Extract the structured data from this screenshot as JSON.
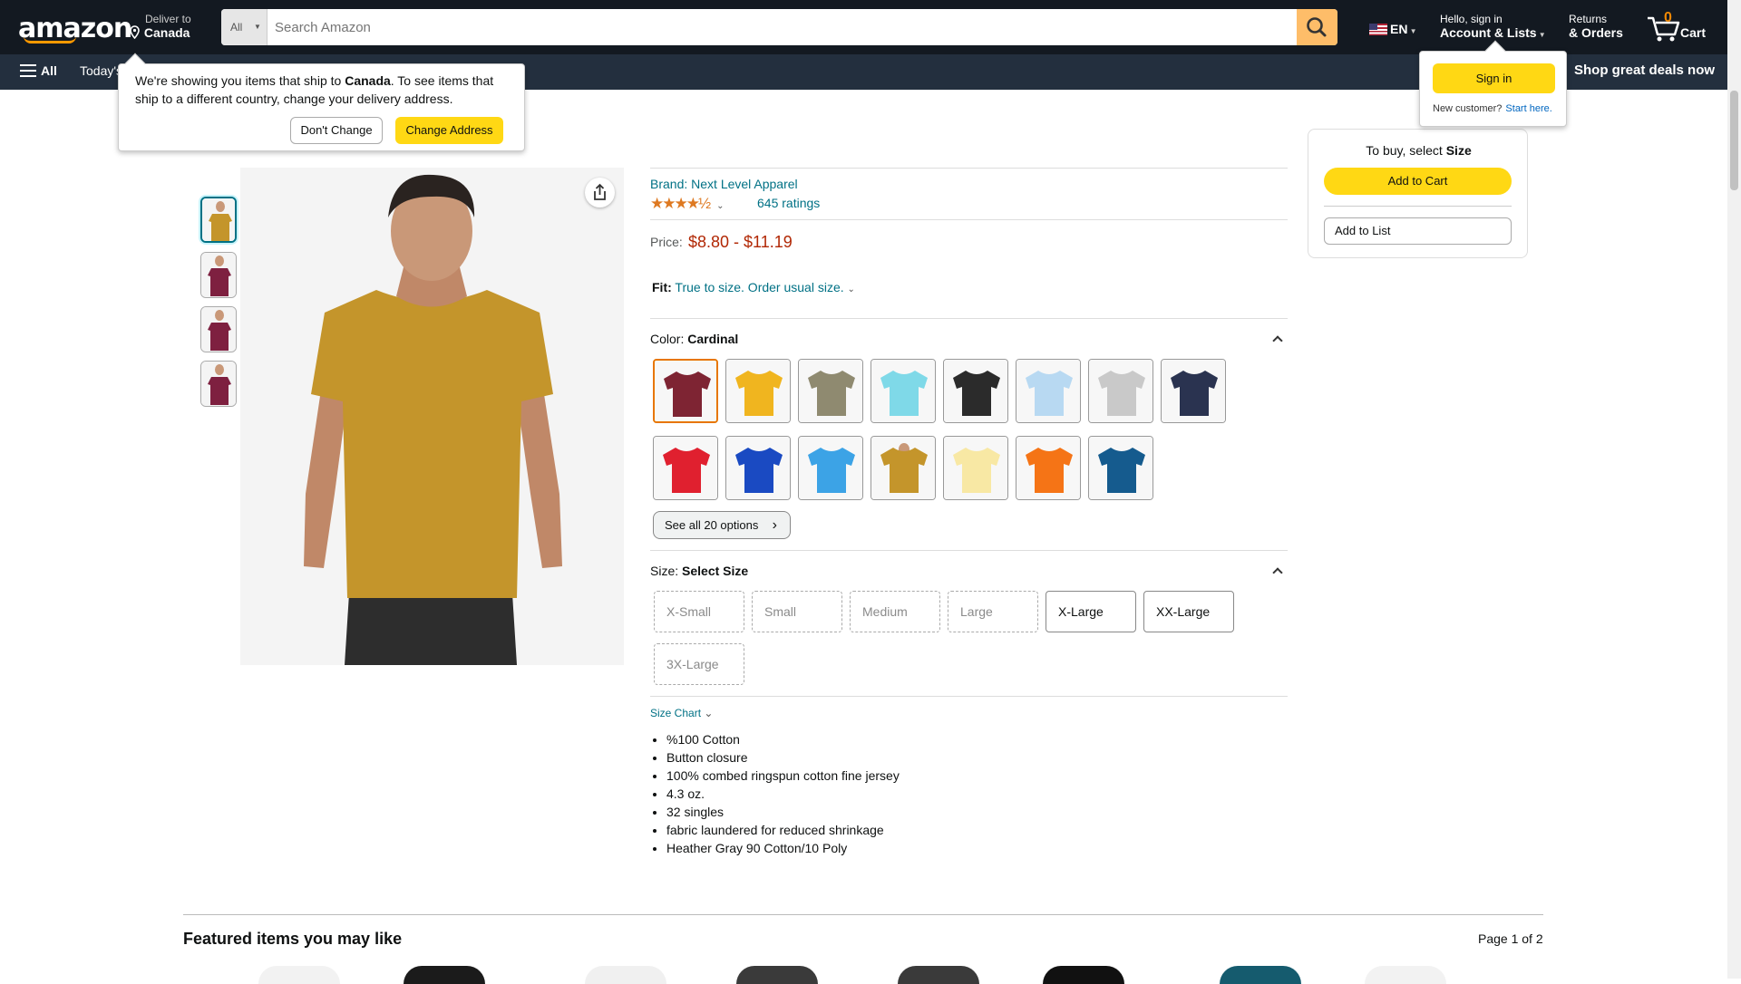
{
  "header": {
    "logo": "amazon",
    "deliver_line1": "Deliver to",
    "deliver_line2": "Canada",
    "search_dept": "All",
    "search_placeholder": "Search Amazon",
    "lang": "EN",
    "account_line1": "Hello, sign in",
    "account_line2": "Account & Lists",
    "returns_line1": "Returns",
    "returns_line2": "& Orders",
    "cart_count": "0",
    "cart_label": "Cart"
  },
  "subnav": {
    "all": "All",
    "today": "Today's",
    "deals": "Shop great deals now"
  },
  "ship_popover": {
    "text_before": "We're showing you items that ship to ",
    "country": "Canada",
    "text_after": ". To see items that ship to a different country, change your delivery address.",
    "dont_change": "Don't Change",
    "change_address": "Change Address"
  },
  "signin_popover": {
    "sign_in": "Sign in",
    "new_customer": "New customer?",
    "start_here": "Start here."
  },
  "product": {
    "brand": "Brand: Next Level Apparel",
    "stars": "★★★★½",
    "ratings": "645 ratings",
    "price_label": "Price:",
    "price": "$8.80 - $11.19",
    "fit_label": "Fit:",
    "fit_value": "True to size. Order usual size.",
    "color_label": "Color:",
    "color_value": "Cardinal",
    "colors": [
      "#7e2433",
      "#f0b51f",
      "#8f8a70",
      "#7fd9e8",
      "#2b2b2b",
      "#b8d9f2",
      "#c9c9c9",
      "#2a3350",
      "#e0202f",
      "#1a4ac2",
      "#3ca3e6",
      "#c4952b",
      "#f8e8a4",
      "#f57416",
      "#155b8e"
    ],
    "see_all": "See all 20 options",
    "size_label": "Size:",
    "size_value": "Select Size",
    "sizes": [
      {
        "label": "X-Small",
        "available": false
      },
      {
        "label": "Small",
        "available": false
      },
      {
        "label": "Medium",
        "available": false
      },
      {
        "label": "Large",
        "available": false
      },
      {
        "label": "X-Large",
        "available": true
      },
      {
        "label": "XX-Large",
        "available": true
      },
      {
        "label": "3X-Large",
        "available": false
      }
    ],
    "size_chart": "Size Chart",
    "bullets": [
      "%100 Cotton",
      "Button closure",
      "100% combed ringspun cotton fine jersey",
      "4.3 oz.",
      "32 singles",
      "fabric laundered for reduced shrinkage",
      "Heather Gray 90 Cotton/10 Poly"
    ],
    "thumb_colors": [
      "#c4952b",
      "#7e2040",
      "#7e2040",
      "#7e2040"
    ]
  },
  "buybox": {
    "to_buy": "To buy, select ",
    "size_word": "Size",
    "add_to_cart": "Add to Cart",
    "add_to_list": "Add to List"
  },
  "featured": {
    "title": "Featured items you may like",
    "page": "Page 1 of 2"
  }
}
